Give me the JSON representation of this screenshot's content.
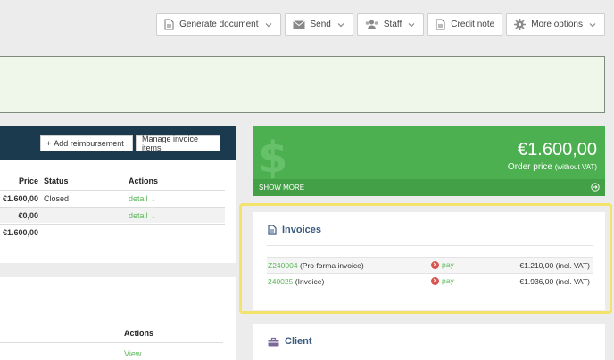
{
  "toolbar": {
    "generate_document": "Generate document",
    "send": "Send",
    "staff": "Staff",
    "credit_note": "Credit note",
    "more_options": "More options"
  },
  "items_panel": {
    "add_reimbursement": "Add reimbursement",
    "manage_invoice_items": "Manage invoice items",
    "columns": {
      "price": "Price",
      "status": "Status",
      "actions": "Actions"
    },
    "rows": [
      {
        "price": "€1.600,00",
        "status": "Closed",
        "action": "detail"
      },
      {
        "price": "€0,00",
        "status": "",
        "action": "detail"
      },
      {
        "price": "€1.600,00",
        "status": "",
        "action": ""
      }
    ]
  },
  "lower_panel": {
    "actions_header": "Actions",
    "view_link": "View"
  },
  "order_price": {
    "amount": "€1.600,00",
    "label": "Order price",
    "label_note": "(without VAT)",
    "show_more": "SHOW MORE"
  },
  "invoices": {
    "title": "Invoices",
    "rows": [
      {
        "number": "Z240004",
        "type": "(Pro forma invoice)",
        "pay_label": "pay",
        "amount": "€1.210,00 (incl. VAT)"
      },
      {
        "number": "240025",
        "type": "(Invoice)",
        "pay_label": "pay",
        "amount": "€1.936,00 (incl. VAT)"
      }
    ]
  },
  "client": {
    "title": "Client"
  },
  "colors": {
    "accent_green": "#4caf50",
    "header_navy": "#1c3a4d",
    "highlight_yellow": "#f3e36a",
    "link_green": "#5cb85c",
    "danger_red": "#d9534f"
  }
}
